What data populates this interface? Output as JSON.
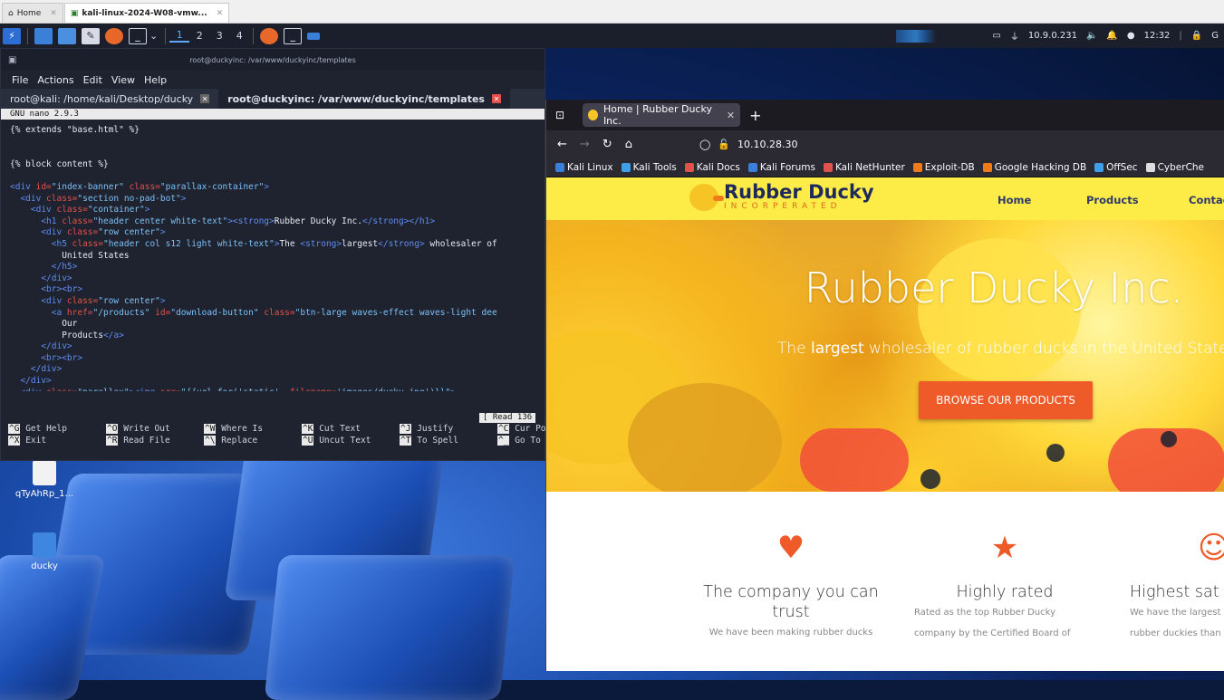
{
  "host_tabs": [
    {
      "label": "Home"
    },
    {
      "label": "kali-linux-2024-W08-vmw..."
    }
  ],
  "panel": {
    "workspaces": [
      "1",
      "2",
      "3",
      "4"
    ],
    "ip": "10.9.0.231",
    "time": "12:32",
    "extra": "G"
  },
  "desktop": {
    "icons": [
      {
        "label": "qTyAhRp_1..."
      },
      {
        "label": "ducky"
      }
    ]
  },
  "terminal": {
    "title": "root@duckyinc: /var/www/duckyinc/templates",
    "menu": [
      "File",
      "Actions",
      "Edit",
      "View",
      "Help"
    ],
    "tabs": [
      {
        "label": "root@kali: /home/kali/Desktop/ducky"
      },
      {
        "label": "root@duckyinc: /var/www/duckyinc/templates"
      }
    ],
    "nano_version": "GNU nano 2.9.3",
    "read_msg": "[ Read 136 ",
    "shortcuts": [
      {
        "k1": "^G",
        "l1": "Get Help",
        "k2": "^X",
        "l2": "Exit"
      },
      {
        "k1": "^O",
        "l1": "Write Out",
        "k2": "^R",
        "l2": "Read File"
      },
      {
        "k1": "^W",
        "l1": "Where Is",
        "k2": "^\\",
        "l2": "Replace"
      },
      {
        "k1": "^K",
        "l1": "Cut Text",
        "k2": "^U",
        "l2": "Uncut Text"
      },
      {
        "k1": "^J",
        "l1": "Justify",
        "k2": "^T",
        "l2": "To Spell"
      },
      {
        "k1": "^C",
        "l1": "Cur Po",
        "k2": "^_",
        "l2": "Go To"
      }
    ]
  },
  "browser": {
    "tab_title": "Home | Rubber Ducky Inc.",
    "url": "10.10.28.30",
    "bookmarks": [
      "Kali Linux",
      "Kali Tools",
      "Kali Docs",
      "Kali Forums",
      "Kali NetHunter",
      "Exploit-DB",
      "Google Hacking DB",
      "OffSec",
      "CyberChe"
    ]
  },
  "site": {
    "logo_main": "Rubber Ducky",
    "logo_sub": "INCORPERATED",
    "nav": [
      "Home",
      "Products",
      "Contac"
    ],
    "hero_title": "Rubber Ducky Inc.",
    "hero_sub_pre": "The ",
    "hero_sub_strong": "largest",
    "hero_sub_post": " wholesaler of rubber ducks in the United State",
    "hero_button": "BROWSE OUR PRODUCTS",
    "features": [
      {
        "title": "The company you can trust",
        "text": "We have been making rubber ducks"
      },
      {
        "title": "Highly rated",
        "text": "Rated as the top Rubber Ducky company by the Certified Board of"
      },
      {
        "title": "Highest sat",
        "text": "We have the largest rubber duckies than"
      }
    ]
  }
}
